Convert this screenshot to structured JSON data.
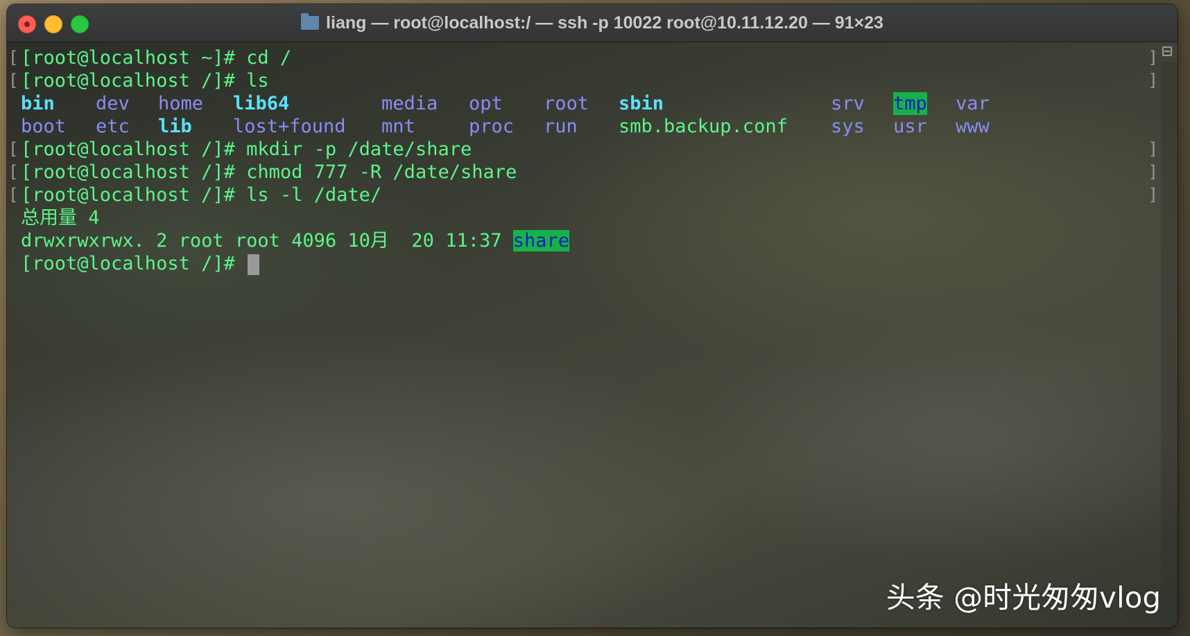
{
  "window": {
    "title": "liang — root@localhost:/ — ssh -p 10022 root@10.11.12.20 — 91×23"
  },
  "terminal": {
    "lines": [
      "[root@localhost ~]# cd /",
      "[root@localhost /]# ls"
    ],
    "ls_row1": [
      "bin",
      "dev",
      "home",
      "lib64",
      "media",
      "opt",
      "root",
      "sbin",
      "srv",
      "tmp",
      "var"
    ],
    "ls_row2": [
      "boot",
      "etc",
      "lib",
      "lost+found",
      "mnt",
      "proc",
      "run",
      "smb.backup.conf",
      "sys",
      "usr",
      "www"
    ],
    "cmd_mkdir": "[root@localhost /]# mkdir -p /date/share",
    "cmd_chmod": "[root@localhost /]# chmod 777 -R /date/share",
    "cmd_ls_l": "[root@localhost /]# ls -l /date/",
    "total": "总用量 4",
    "ls_l_entry": "drwxrwxrwx. 2 root root 4096 10月  20 11:37 ",
    "ls_l_name": "share",
    "prompt": "[root@localhost /]# "
  },
  "watermark": "头条 @时光匆匆vlog",
  "colors": {
    "text": "#5cf58a",
    "dir": "#8a8cf5",
    "highlight_bg": "#17b14a"
  }
}
